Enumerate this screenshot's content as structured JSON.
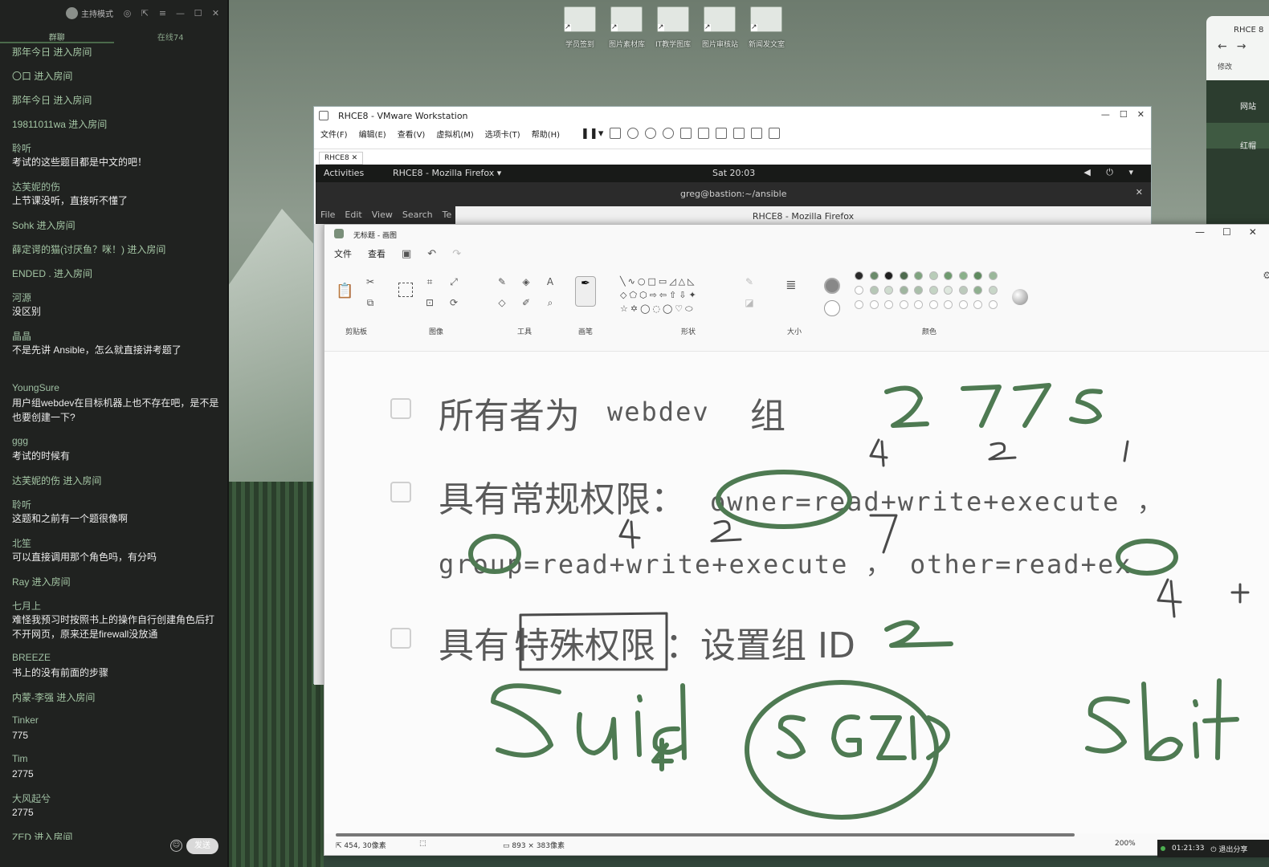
{
  "chat": {
    "mode_label": "主持模式",
    "tabs": [
      "群聊",
      "在线74"
    ],
    "send_label": "发送",
    "messages": [
      {
        "type": "enter",
        "text": "那年今日 进入房间"
      },
      {
        "type": "enter",
        "text": "〇口 进入房间"
      },
      {
        "type": "enter",
        "text": "那年今日 进入房间"
      },
      {
        "type": "enter",
        "text": "19811011wa 进入房间"
      },
      {
        "type": "msg",
        "name": "聆听",
        "text": "考试的这些题目都是中文的吧！"
      },
      {
        "type": "msg",
        "name": "达芙妮的伤",
        "text": "上节课没听，直接听不懂了"
      },
      {
        "type": "enter",
        "text": "Sohk 进入房间"
      },
      {
        "type": "enter",
        "text": "薛定谔的猫(讨厌鱼？咪！) 进入房间"
      },
      {
        "type": "enter",
        "text": "ENDED . 进入房间"
      },
      {
        "type": "msg",
        "name": "河源",
        "text": "没区别"
      },
      {
        "type": "msg",
        "name": "晶晶",
        "text": "不是先讲 Ansible，怎么就直接讲考题了"
      },
      {
        "type": "msg",
        "name": "YoungSure",
        "text": "用户组webdev在目标机器上也不存在吧，是不是也要创建一下?"
      },
      {
        "type": "msg",
        "name": "ggg",
        "text": "考试的时候有"
      },
      {
        "type": "enter",
        "text": "达芙妮的伤 进入房间"
      },
      {
        "type": "msg",
        "name": "聆听",
        "text": "这题和之前有一个题很像啊"
      },
      {
        "type": "msg",
        "name": "北笙",
        "text": "可以直接调用那个角色吗，有分吗"
      },
      {
        "type": "enter",
        "text": "Ray 进入房间"
      },
      {
        "type": "msg",
        "name": "七月上",
        "text": "难怪我预习时按照书上的操作自行创建角色后打不开网页，原来还是firewall没放通"
      },
      {
        "type": "msg",
        "name": "BREEZE",
        "text": "书上的没有前面的步骤"
      },
      {
        "type": "enter",
        "text": "内蒙-李强 进入房间"
      },
      {
        "type": "msg",
        "name": "Tinker",
        "text": "775"
      },
      {
        "type": "msg",
        "name": "Tim",
        "text": "2775"
      },
      {
        "type": "msg",
        "name": "大风起兮",
        "text": "2775"
      },
      {
        "type": "enter",
        "text": "ZED 进入房间"
      }
    ]
  },
  "desktop": {
    "icons": [
      "学员签到",
      "图片素材库",
      "IT教学图库",
      "图片审核站",
      "新闻发文室"
    ],
    "peek": {
      "title": "RHCE 8",
      "bookmark": "修改",
      "item1": "网站",
      "item2": "红帽"
    }
  },
  "vmware": {
    "title": "RHCE8 - VMware Workstation",
    "menu": [
      "文件(F)",
      "编辑(E)",
      "查看(V)",
      "虚拟机(M)",
      "选项卡(T)",
      "帮助(H)"
    ],
    "tab": "RHCE8",
    "gnome": {
      "activities": "Activities",
      "app": "RHCE8 - Mozilla Firefox ▾",
      "clock": "Sat 20:03",
      "sys": "◀ ⏻ ▾"
    },
    "terminal": {
      "title": "greg@bastion:~/ansible",
      "menu": [
        "File",
        "Edit",
        "View",
        "Search",
        "Te"
      ],
      "firefox": "RHCE8 - Mozilla Firefox"
    }
  },
  "paint": {
    "title": "无标题 - 画图",
    "menu": [
      "文件",
      "查看"
    ],
    "groups": [
      "剪贴板",
      "图像",
      "工具",
      "画笔",
      "形状",
      "大小",
      "颜色"
    ],
    "canvas": {
      "line1_cn": "所有者为",
      "line1_en": "webdev",
      "line1_end": "组",
      "line2_cn": "具有常规权限：",
      "line2_en": "owner=read+write+execute ，",
      "line3": "group=read+write+execute ， other=read+ex",
      "line4_a": "具有",
      "line4_b": "特殊权限",
      "line4_c": "：设置组 ID"
    },
    "status": {
      "cursor": "454, 30像素",
      "selection": "",
      "size": "893 × 383像素",
      "zoom": "200%"
    }
  },
  "share": {
    "time": "01:21:33",
    "exit": "退出分享"
  }
}
